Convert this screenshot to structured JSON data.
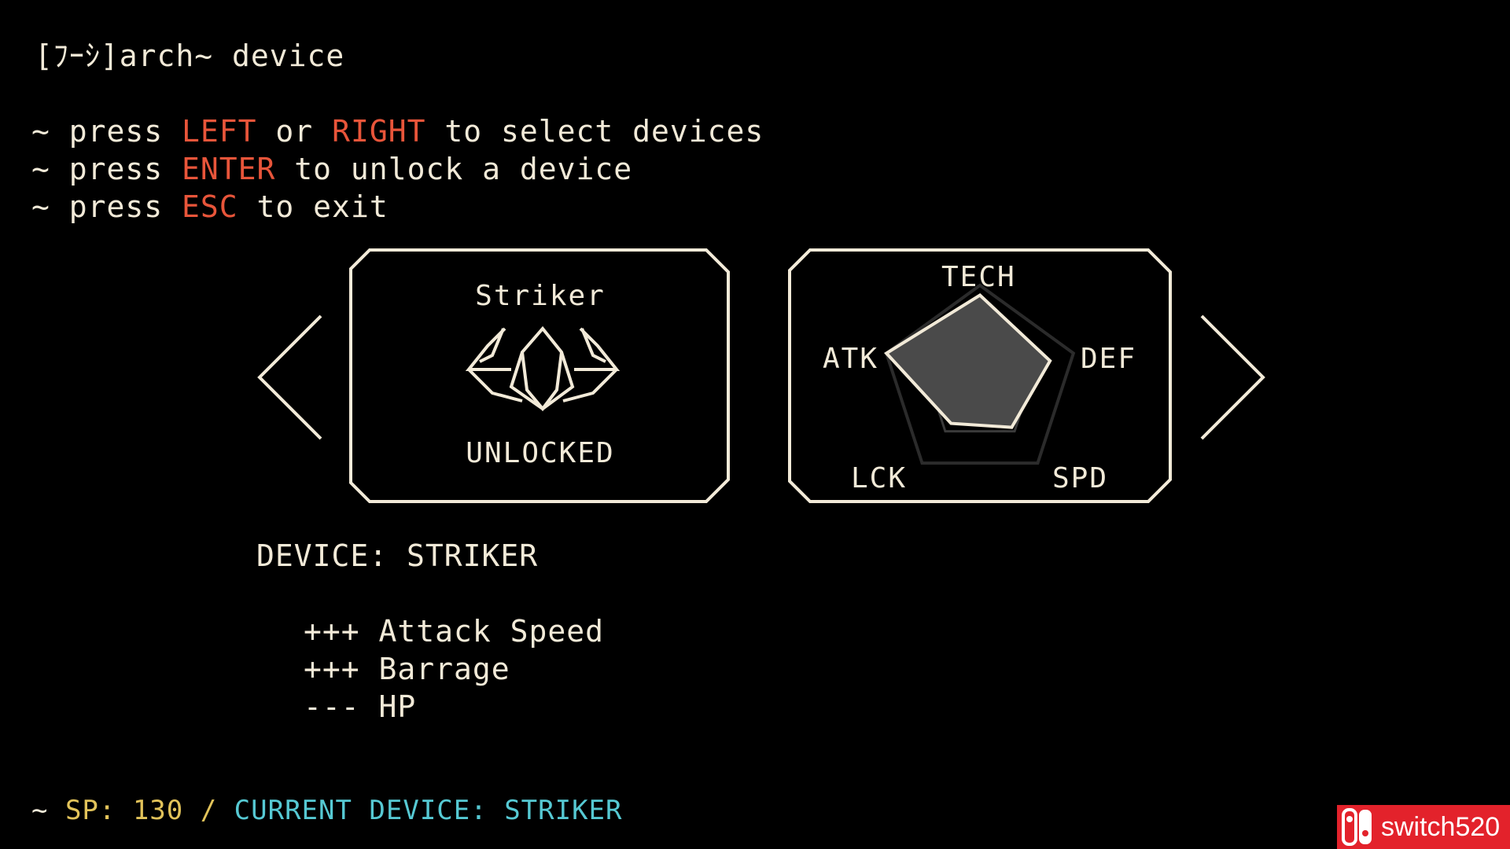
{
  "header": {
    "title": "[ﾌｰｼ]arch~ device"
  },
  "instructions": [
    {
      "prefix": "~ press ",
      "key": "LEFT",
      "mid": " or ",
      "key2": "RIGHT",
      "suffix": " to select devices"
    },
    {
      "prefix": "~ press ",
      "key": "ENTER",
      "suffix": " to unlock a device"
    },
    {
      "prefix": "~ press ",
      "key": "ESC",
      "suffix": " to exit"
    }
  ],
  "device_card": {
    "name": "Striker",
    "status": "UNLOCKED",
    "icon": "striker-ship-icon"
  },
  "stats_card": {
    "labels": {
      "tech": "TECH",
      "atk": "ATK",
      "def": "DEF",
      "lck": "LCK",
      "spd": "SPD"
    },
    "values": {
      "tech": 0.9,
      "def": 0.75,
      "spd": 0.55,
      "lck": 0.5,
      "atk": 1.0
    }
  },
  "details": {
    "device_label": "DEVICE: STRIKER",
    "modifiers": [
      "+++ Attack Speed",
      "+++ Barrage",
      "--- HP"
    ]
  },
  "footer": {
    "tilde": "~ ",
    "sp": "SP: 130",
    "sep": " / ",
    "current": "CURRENT DEVICE: STRIKER"
  },
  "nav": {
    "left_icon": "chevron-left-icon",
    "right_icon": "chevron-right-icon"
  },
  "watermark": {
    "text": "switch520",
    "color": "#e3222b"
  },
  "colors": {
    "text": "#f2ead8",
    "highlight": "#e8553a",
    "sp": "#e2c35a",
    "current": "#56c9d3"
  }
}
